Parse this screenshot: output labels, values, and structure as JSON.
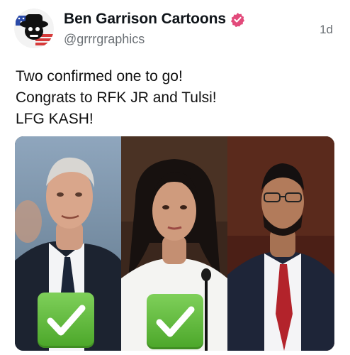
{
  "post": {
    "author_name": "Ben Garrison Cartoons",
    "handle": "@grrrgraphics",
    "time_ago": "1d",
    "text_lines": [
      "Two confirmed one to go!",
      "Congrats to RFK JR and Tulsi!",
      "LFG KASH!"
    ]
  },
  "icons": {
    "verified": "verified-badge-icon",
    "check": "check-mark-button-icon"
  },
  "colors": {
    "verified_badge": "#e24a7b",
    "check_green": "#5cb836",
    "handle_gray": "#6b7075"
  }
}
